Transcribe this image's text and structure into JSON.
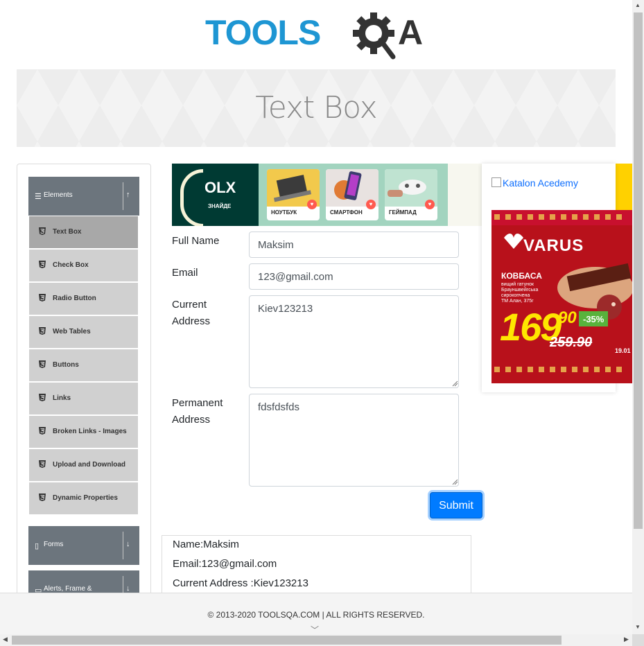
{
  "logo": {
    "text": "TOOLSQA",
    "primary_color": "#1e96d3",
    "dark_color": "#333333"
  },
  "page": {
    "title": "Text Box"
  },
  "sidebar": {
    "groups": [
      {
        "title": "Elements",
        "expanded": true,
        "arrow": "↑",
        "items": [
          {
            "label": "Text Box",
            "active": true
          },
          {
            "label": "Check Box"
          },
          {
            "label": "Radio Button"
          },
          {
            "label": "Web Tables"
          },
          {
            "label": "Buttons"
          },
          {
            "label": "Links"
          },
          {
            "label": "Broken Links - Images"
          },
          {
            "label": "Upload and Download"
          },
          {
            "label": "Dynamic Properties"
          }
        ]
      },
      {
        "title": "Forms",
        "expanded": false,
        "arrow": "↓"
      },
      {
        "title": "Alerts, Frame &",
        "expanded": false,
        "arrow": "↓"
      }
    ]
  },
  "ad_top": {
    "brand": "OLX",
    "slogan": "ЗНАЙДЕ",
    "products": [
      "НОУТБУК",
      "СМАРТФОН",
      "ГЕЙМПАД"
    ]
  },
  "form": {
    "full_name_label": "Full Name",
    "full_name_value": "Maksim",
    "email_label": "Email",
    "email_value": "123@gmail.com",
    "current_address_label_1": "Current",
    "current_address_label_2": "Address",
    "current_address_value": "Kiev123213",
    "permanent_address_label_1": "Permanent",
    "permanent_address_label_2": "Address",
    "permanent_address_value": "fdsfdsfds",
    "submit_label": "Submit"
  },
  "output": {
    "name": "Name:Maksim",
    "email": "Email:123@gmail.com",
    "current_address": "Current Address :Kiev123213"
  },
  "side_ad": {
    "alt_text": "Katalon Acedemy",
    "brand": "VARUS",
    "product": "КОВБАСА",
    "description": [
      "вищий гатунок",
      "Брауншвейгська",
      "сирокопчена",
      "ТМ Алан, 375г"
    ],
    "price": "169",
    "price_cents": "90",
    "old_price": "259.90",
    "discount": "-35%",
    "date": "19.01"
  },
  "footer": {
    "copyright": "© 2013-2020 TOOLSQA.COM | ALL RIGHTS RESERVED."
  },
  "colors": {
    "accent": "#007bff",
    "sidebar_header": "#6c757d",
    "sidebar_item": "#d0d0d0",
    "sidebar_active": "#a8a8a8"
  }
}
